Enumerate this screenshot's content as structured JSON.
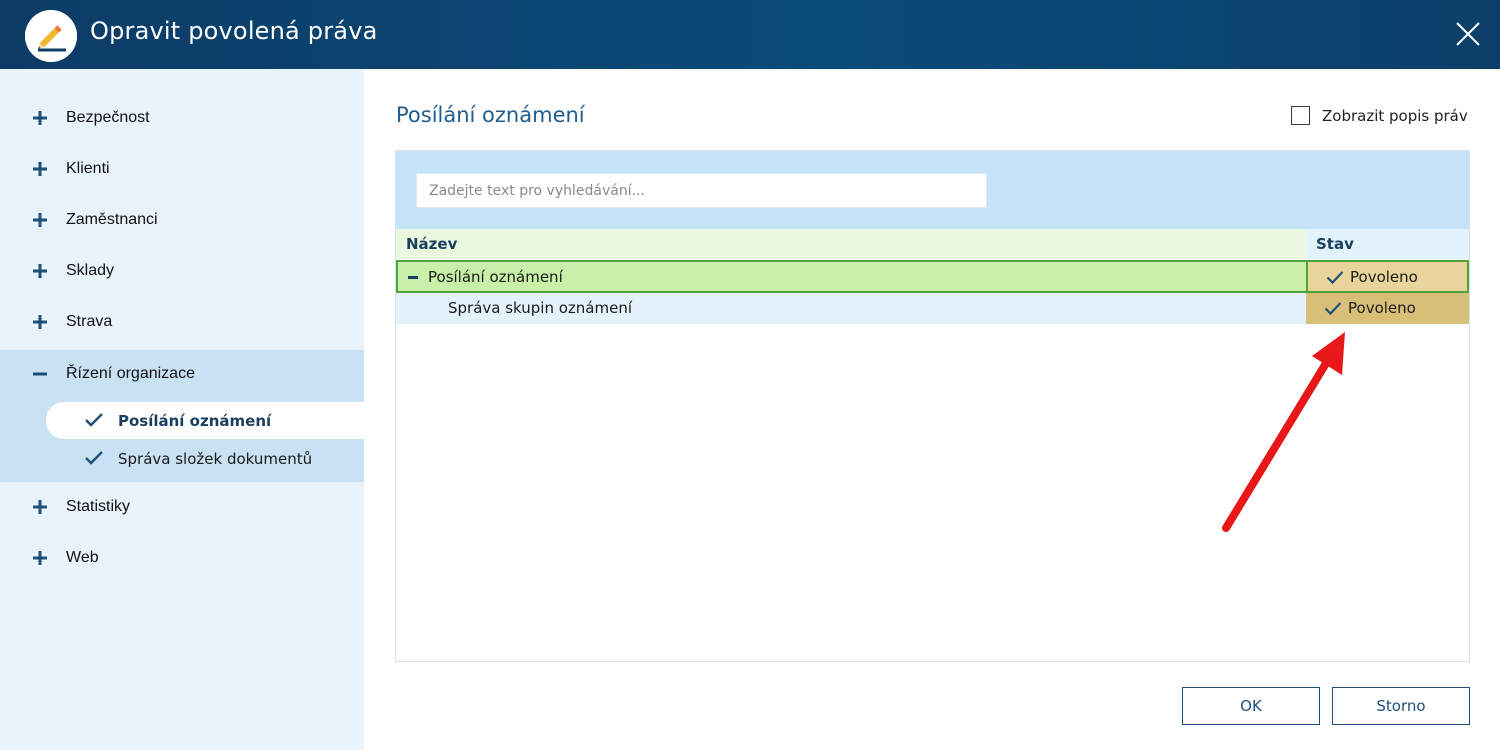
{
  "window": {
    "title": "Opravit povolená práva",
    "close_icon": "close-icon",
    "app_icon": "pencil-icon",
    "titlebar_color": "#0c3c66"
  },
  "sidebar": {
    "items": [
      {
        "label": "Bezpečnost",
        "icon": "plus-icon"
      },
      {
        "label": "Klienti",
        "icon": "plus-icon"
      },
      {
        "label": "Zaměstnanci",
        "icon": "plus-icon"
      },
      {
        "label": "Sklady",
        "icon": "plus-icon"
      },
      {
        "label": "Strava",
        "icon": "plus-icon"
      },
      {
        "label": "Řízení organizace",
        "icon": "minus-icon",
        "expanded": true,
        "children": [
          {
            "label": "Posílání oznámení",
            "icon": "checkmark-icon",
            "active": true
          },
          {
            "label": "Správa složek dokumentů",
            "icon": "checkmark-icon"
          }
        ]
      },
      {
        "label": "Statistiky",
        "icon": "plus-icon"
      },
      {
        "label": "Web",
        "icon": "plus-icon"
      }
    ]
  },
  "main": {
    "section_title": "Posílání oznámení",
    "show_description_label": "Zobrazit popis práv",
    "show_description_checked": false,
    "search": {
      "placeholder": "Zadejte text pro vyhledávání...",
      "value": ""
    },
    "columns": {
      "name": "Název",
      "status": "Stav"
    },
    "rows": [
      {
        "name": "Posílání oznámení",
        "status": "Povoleno",
        "toggle": "minus-icon",
        "selected": true
      },
      {
        "name": "Správa skupin oznámení",
        "status": "Povoleno"
      }
    ],
    "annotation": "red-arrow-icon",
    "colors": {
      "selected_row": "#c8f0a8",
      "status_cell": "#e9d49c",
      "accent": "#1f5d8e"
    }
  },
  "buttons": {
    "ok": "OK",
    "cancel": "Storno"
  }
}
